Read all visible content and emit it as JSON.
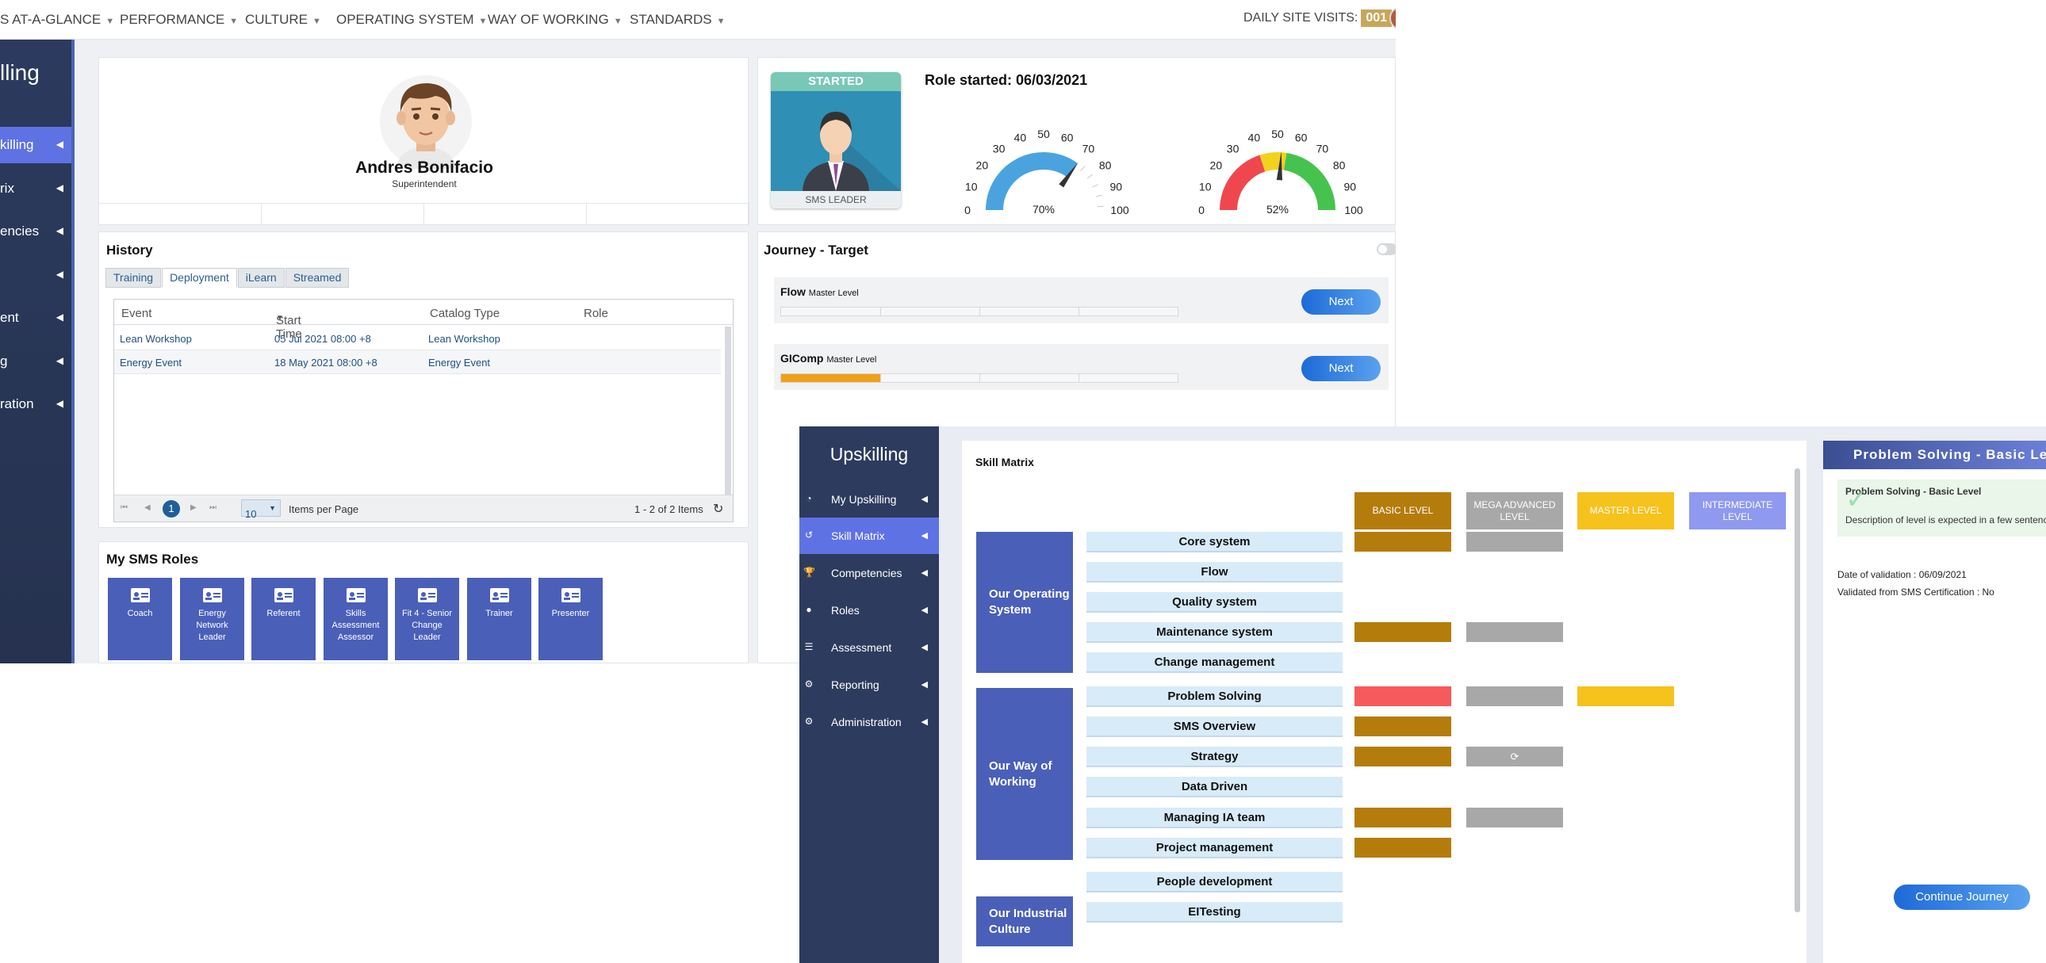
{
  "topbar": {
    "nav": [
      "S AT-A-GLANCE",
      "PERFORMANCE",
      "CULTURE",
      "OPERATING SYSTEM",
      "WAY OF WORKING",
      "STANDARDS"
    ],
    "visits_label": "DAILY SITE VISITS:",
    "visits_count": "001"
  },
  "left_sidebar": {
    "title": "lling",
    "items": [
      "killing",
      "rix",
      "encies",
      "",
      "ent",
      "g",
      "ration"
    ]
  },
  "profile": {
    "name": "Andres Bonifacio",
    "role": "Superintendent"
  },
  "role_card": {
    "badge_status": "STARTED",
    "badge_title": "SMS LEADER",
    "role_started": "Role started: 06/03/2021",
    "gauge1": {
      "value_label": "70%",
      "value": 70,
      "ticks": [
        "0",
        "10",
        "20",
        "30",
        "40",
        "50",
        "60",
        "70",
        "80",
        "90",
        "100"
      ]
    },
    "gauge2": {
      "value_label": "52%",
      "value": 52,
      "ticks": [
        "0",
        "10",
        "20",
        "30",
        "40",
        "50",
        "60",
        "70",
        "80",
        "90",
        "100"
      ]
    },
    "colors": {
      "gauge_blue": "#4aa3df",
      "red": "#f0474e",
      "yellow": "#f3d21e",
      "green": "#45c34e"
    }
  },
  "history": {
    "title": "History",
    "tabs": [
      "Training",
      "Deployment",
      "iLearn",
      "Streamed"
    ],
    "columns": [
      "Event",
      "Start Time",
      "Catalog Type",
      "Role"
    ],
    "rows": [
      [
        "Lean Workshop",
        "05 Jul 2021 08:00 +8",
        "Lean Workshop",
        ""
      ],
      [
        "Energy Event",
        "18 May 2021 08:00 +8",
        "Energy Event",
        ""
      ]
    ],
    "pager": {
      "page": "1",
      "size": "10",
      "items_per_page": "Items per Page",
      "summary": "1 - 2 of 2 Items"
    }
  },
  "sms_roles": {
    "title": "My SMS Roles",
    "roles": [
      "Coach",
      "Energy Network Leader",
      "Referent",
      "Skills Assessment Assessor",
      "Fit 4 - Senior Change Leader",
      "Trainer",
      "Presenter"
    ]
  },
  "journey": {
    "title": "Journey - Target",
    "rows": [
      {
        "name": "Flow",
        "level": "Master Level",
        "progress": 0,
        "next": "Next"
      },
      {
        "name": "GIComp",
        "level": "Master Level",
        "progress": 0.25,
        "next": "Next"
      }
    ]
  },
  "upskilling": {
    "title": "Upskilling",
    "menu": [
      {
        "label": "My Upskilling",
        "icon": "gauge-icon"
      },
      {
        "label": "Skill Matrix",
        "icon": "history-icon"
      },
      {
        "label": "Competencies",
        "icon": "trophy-icon"
      },
      {
        "label": "Roles",
        "icon": "user-icon"
      },
      {
        "label": "Assessment",
        "icon": "list-icon"
      },
      {
        "label": "Reporting",
        "icon": "gear-icon"
      },
      {
        "label": "Administration",
        "icon": "gear-icon"
      }
    ],
    "matrix_title": "Skill Matrix",
    "levels": [
      {
        "label": "BASIC LEVEL",
        "color": "#b47c0b"
      },
      {
        "label": "MEGA ADVANCED LEVEL",
        "color": "#a8a8a8"
      },
      {
        "label": "MASTER LEVEL",
        "color": "#f6c21c"
      },
      {
        "label": "INTERMEDIATE LEVEL",
        "color": "#8f99f0"
      }
    ],
    "groups": [
      "Our Operating System",
      "Our Way of Working",
      "Our Industrial Culture"
    ],
    "skills": [
      "Core system",
      "Flow",
      "Quality system",
      "Maintenance system",
      "Change management",
      "Problem Solving",
      "SMS Overview",
      "Strategy",
      "Data Driven",
      "Managing IA team",
      "Project management",
      "People development",
      "EITesting"
    ],
    "panel": {
      "title": "Problem Solving - Basic Level",
      "note_title": "Problem Solving - Basic Level",
      "note_desc": "Description of level is expected in a few sentences",
      "validation_date": "Date of validation : 06/09/2021",
      "validated_from": "Validated from SMS Certification : No",
      "continue": "Continue Journey"
    }
  }
}
